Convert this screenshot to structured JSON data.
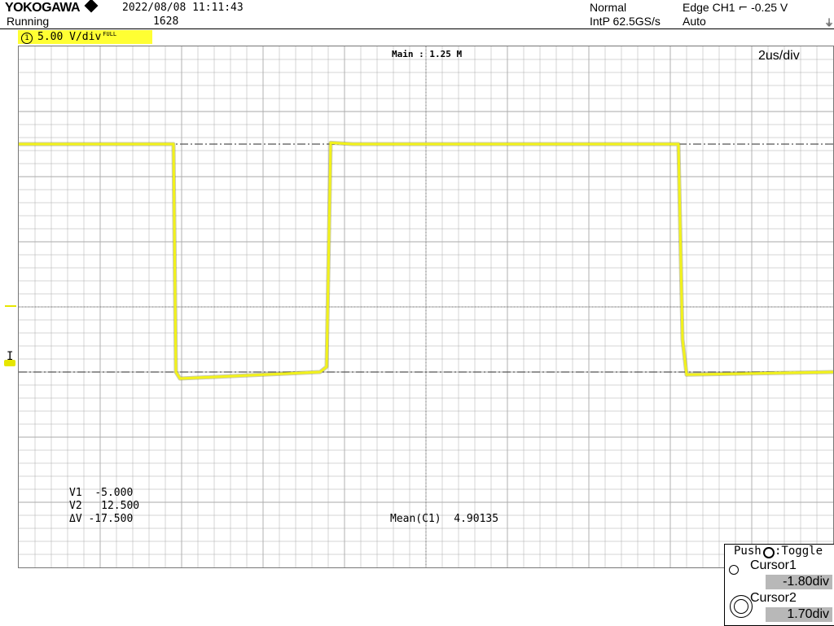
{
  "header": {
    "brand": "YOKOGAWA",
    "datetime": "2022/08/08  11:11:43",
    "status": "Running",
    "count": "1628",
    "acq_mode": "Normal",
    "sample_rate": "IntP 62.5GS/s",
    "trigger": "Edge CH1",
    "trigger_level": "-0.25 V",
    "trigger_mode": "Auto"
  },
  "channel": {
    "number": "1",
    "vdiv": "5.00 V/div",
    "bw_mark": "FULL"
  },
  "plot": {
    "main_label": "Main : 1.25 M",
    "timebase": "2us/div"
  },
  "readouts": {
    "v1_label": "V1",
    "v1_value": "-5.000",
    "v2_label": "V2",
    "v2_value": "12.500",
    "dv_label": "ΔV",
    "dv_value": "-17.500",
    "mean_label": "Mean(C1)",
    "mean_value": "4.90135"
  },
  "cursor_panel": {
    "push_label": "Push",
    "toggle_label": ":Toggle",
    "cursor1_label": "Cursor1",
    "cursor1_value": "-1.80div",
    "cursor2_label": "Cursor2",
    "cursor2_value": "1.70div"
  },
  "colors": {
    "trace": "#f2f21a",
    "grid": "#aaaaaa",
    "cursor_line": "#555555",
    "channel_bg": "#ffff33"
  },
  "chart_data": {
    "type": "line",
    "x_unit": "div",
    "y_unit": "V",
    "xlim": [
      0,
      10
    ],
    "ylim": [
      -20,
      20
    ],
    "series": [
      {
        "x": [
          0,
          1.9,
          1.93,
          1.98,
          3.7,
          3.78,
          3.83,
          4.1,
          8.1,
          8.15,
          8.2,
          10.0
        ],
        "values": [
          12.5,
          12.5,
          -5.0,
          -5.5,
          -5.0,
          -4.6,
          12.6,
          12.5,
          12.5,
          -2.5,
          -5.2,
          -5.0
        ]
      }
    ],
    "cursors": {
      "v1": -5.0,
      "v2": 12.5
    }
  }
}
